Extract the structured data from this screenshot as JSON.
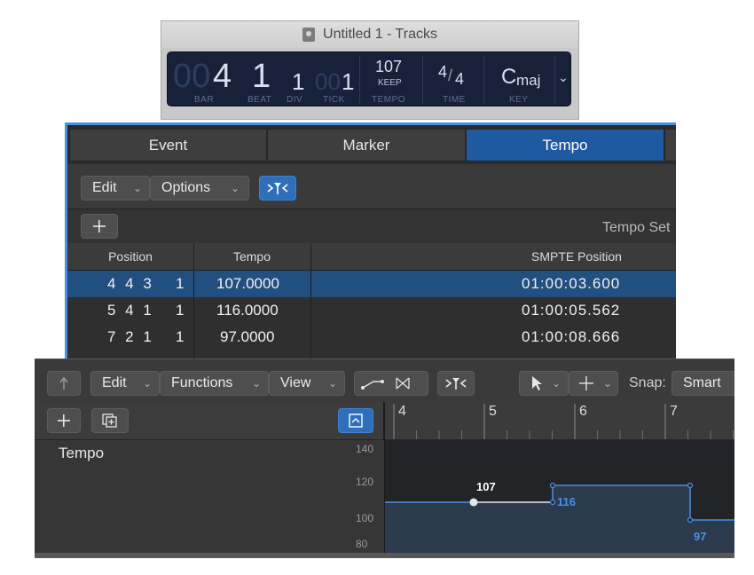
{
  "window_title": "Untitled 1 - Tracks",
  "lcd": {
    "bar_dim": "00",
    "bar": "4",
    "beat": "1",
    "div": "1",
    "tick_dim": "00",
    "tick": "1",
    "tempo": "107",
    "tempo_mode": "KEEP",
    "time_num": "4",
    "time_den": "4",
    "key": "C",
    "key_mode": "maj",
    "captions": {
      "bar": "BAR",
      "beat": "BEAT",
      "div": "DIV",
      "tick": "TICK",
      "tempo": "TEMPO",
      "time": "TIME",
      "key": "KEY"
    },
    "dropdown_icon": "chevron-down-icon"
  },
  "list_editor": {
    "tabs": [
      "Event",
      "Marker",
      "Tempo"
    ],
    "active_tab": "Tempo",
    "toolbar": {
      "edit": "Edit",
      "options": "Options",
      "catch_icon": "catch-playhead-icon"
    },
    "add_icon": "plus-icon",
    "tempo_set_label": "Tempo Set",
    "columns": [
      "Position",
      "Tempo",
      "SMPTE Position"
    ],
    "rows": [
      {
        "position": "4 4 3",
        "sub": "1",
        "tempo": "107.0000",
        "smpte": "01:00:03.600",
        "selected": true
      },
      {
        "position": "5 4 1",
        "sub": "1",
        "tempo": "116.0000",
        "smpte": "01:00:05.562",
        "selected": false
      },
      {
        "position": "7 2 1",
        "sub": "1",
        "tempo": "97.0000",
        "smpte": "01:00:08.666",
        "selected": false
      }
    ],
    "accent": "#1f5aa1"
  },
  "tempo_track": {
    "toolbar": {
      "edit": "Edit",
      "functions": "Functions",
      "view": "View",
      "snap_label": "Snap:",
      "snap_value": "Smart"
    },
    "ruler_bars": [
      "4",
      "5",
      "6",
      "7"
    ],
    "track_name": "Tempo",
    "y_ticks": [
      "140",
      "120",
      "100",
      "80"
    ],
    "labels": {
      "p1": "107",
      "p2": "116",
      "p3": "97"
    },
    "accent": "#4a90e2"
  }
}
